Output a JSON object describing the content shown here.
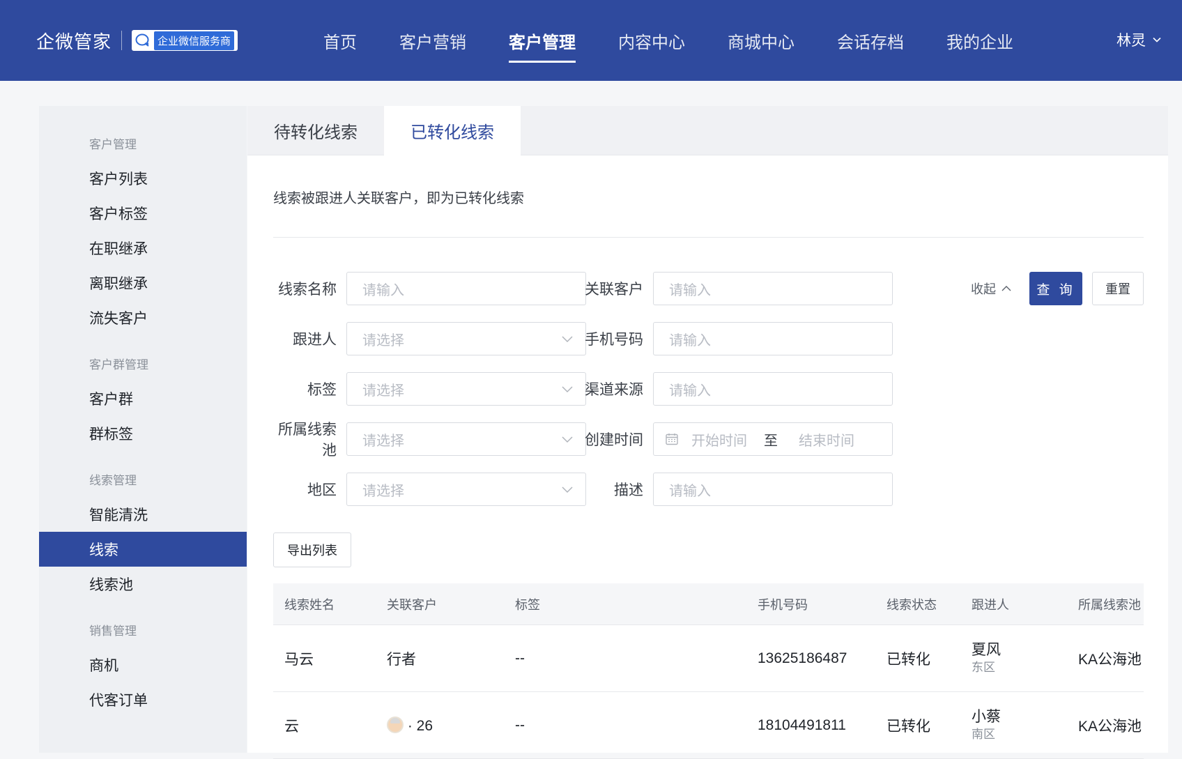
{
  "header": {
    "brand": "企微管家",
    "badge": "企业微信服务商",
    "nav": [
      "首页",
      "客户营销",
      "客户管理",
      "内容中心",
      "商城中心",
      "会话存档",
      "我的企业"
    ],
    "active_nav": "客户管理",
    "user": "林灵"
  },
  "sidebar": {
    "groups": [
      {
        "title": "客户管理",
        "items": [
          "客户列表",
          "客户标签",
          "在职继承",
          "离职继承",
          "流失客户"
        ]
      },
      {
        "title": "客户群管理",
        "items": [
          "客户群",
          "群标签"
        ]
      },
      {
        "title": "线索管理",
        "items": [
          "智能清洗",
          "线索",
          "线索池"
        ]
      },
      {
        "title": "销售管理",
        "items": [
          "商机",
          "代客订单"
        ]
      }
    ],
    "active": "线索"
  },
  "tabs": [
    "待转化线索",
    "已转化线索"
  ],
  "active_tab": "已转化线索",
  "description": "线索被跟进人关联客户，即为已转化线索",
  "filters": {
    "lead_name": {
      "label": "线索名称",
      "placeholder": "请输入"
    },
    "related_customer": {
      "label": "关联客户",
      "placeholder": "请输入"
    },
    "follower": {
      "label": "跟进人",
      "placeholder": "请选择"
    },
    "phone": {
      "label": "手机号码",
      "placeholder": "请输入"
    },
    "tag": {
      "label": "标签",
      "placeholder": "请选择"
    },
    "channel": {
      "label": "渠道来源",
      "placeholder": "请输入"
    },
    "pool": {
      "label": "所属线索池",
      "placeholder": "请选择"
    },
    "created": {
      "label": "创建时间",
      "start": "开始时间",
      "to": "至",
      "end": "结束时间"
    },
    "region": {
      "label": "地区",
      "placeholder": "请选择"
    },
    "desc": {
      "label": "描述",
      "placeholder": "请输入"
    }
  },
  "actions": {
    "fold": "收起",
    "query": "查 询",
    "reset": "重置",
    "export": "导出列表"
  },
  "table": {
    "columns": [
      "线索姓名",
      "关联客户",
      "标签",
      "手机号码",
      "线索状态",
      "跟进人",
      "所属线索池"
    ],
    "rows": [
      {
        "name": "马云",
        "customer": "行者",
        "tag": "--",
        "phone": "13625186487",
        "status": "已转化",
        "follower": "夏风",
        "area": "东区",
        "pool": "KA公海池"
      },
      {
        "name": "云",
        "customer": "· 26",
        "tag": "--",
        "phone": "18104491811",
        "status": "已转化",
        "follower": "小蔡",
        "area": "南区",
        "pool": "KA公海池"
      }
    ]
  },
  "colors": {
    "primary": "#2f4a9e",
    "sidebar_bg": "#eef0f3",
    "page_bg": "#f5f6f8"
  }
}
